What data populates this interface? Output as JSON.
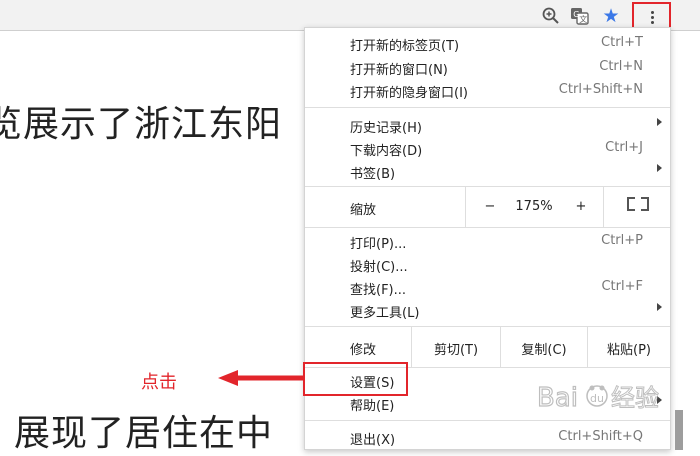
{
  "page": {
    "text_line1": "览展示了浙江东阳",
    "text_line2": "展现了居住在中"
  },
  "toolbar": {
    "icons": [
      "zoom-in-icon",
      "translate-icon",
      "bookmark-star-icon",
      "more-vert-icon"
    ],
    "star_color": "#3b78e7"
  },
  "menu": {
    "new_tab": {
      "label": "打开新的标签页(T)",
      "shortcut": "Ctrl+T"
    },
    "new_window": {
      "label": "打开新的窗口(N)",
      "shortcut": "Ctrl+N"
    },
    "incognito": {
      "label": "打开新的隐身窗口(I)",
      "shortcut": "Ctrl+Shift+N"
    },
    "history": {
      "label": "历史记录(H)"
    },
    "downloads": {
      "label": "下载内容(D)",
      "shortcut": "Ctrl+J"
    },
    "bookmarks": {
      "label": "书签(B)"
    },
    "zoom": {
      "label": "缩放",
      "minus": "−",
      "value": "175%",
      "plus": "+"
    },
    "print": {
      "label": "打印(P)...",
      "shortcut": "Ctrl+P"
    },
    "cast": {
      "label": "投射(C)..."
    },
    "find": {
      "label": "查找(F)...",
      "shortcut": "Ctrl+F"
    },
    "more_tools": {
      "label": "更多工具(L)"
    },
    "edit": {
      "label": "修改",
      "cut": "剪切(T)",
      "copy": "复制(C)",
      "paste": "粘贴(P)"
    },
    "settings": {
      "label": "设置(S)"
    },
    "help": {
      "label": "帮助(E)"
    },
    "exit": {
      "label": "退出(X)",
      "shortcut": "Ctrl+Shift+Q"
    }
  },
  "annotation": {
    "text": "点击",
    "color": "#e2252b"
  },
  "watermark": {
    "text": "Baidu 经验"
  }
}
